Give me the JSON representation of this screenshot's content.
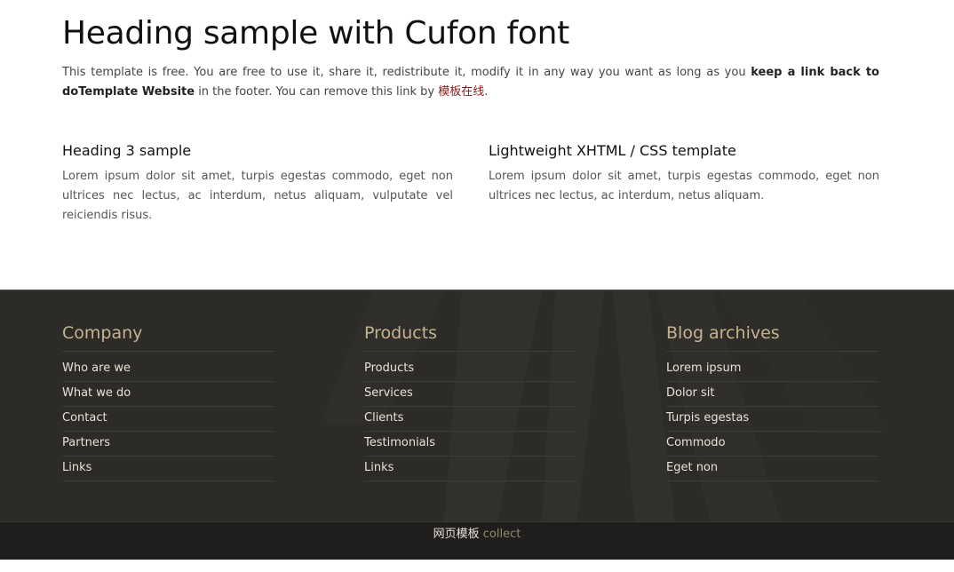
{
  "main": {
    "heading": "Heading sample with Cufon font",
    "intro": {
      "text1": "This template is free. You are free to use it, share it, redistribute it, modify it in any way you want as long as you ",
      "bold": "keep a link back to doTemplate Website",
      "text2": " in the footer. You can remove this link by ",
      "link": "模板在线",
      "text3": "."
    },
    "columns": [
      {
        "heading": "Heading 3 sample",
        "body": "Lorem ipsum dolor sit amet, turpis egestas commodo, eget non ultrices nec lectus, ac interdum, netus aliquam, vulputate vel reiciendis risus."
      },
      {
        "heading": "Lightweight XHTML / CSS template",
        "body": "Lorem ipsum dolor sit amet, turpis egestas commodo, eget non ultrices nec lectus, ac interdum, netus aliquam."
      }
    ]
  },
  "footer": {
    "columns": [
      {
        "title": "Company",
        "links": [
          "Who are we",
          "What we do",
          "Contact",
          "Partners",
          "Links"
        ]
      },
      {
        "title": "Products",
        "links": [
          "Products",
          "Services",
          "Clients",
          "Testimonials",
          "Links"
        ]
      },
      {
        "title": "Blog archives",
        "links": [
          "Lorem ipsum",
          "Dolor sit",
          "Turpis egestas",
          "Commodo",
          "Eget non"
        ]
      }
    ],
    "bottom_link1": "网页模板",
    "bottom_link2": "collect"
  },
  "colors": {
    "footer_bg": "#2c2b28",
    "footer_heading": "#c6b38e",
    "link_red": "#8b1a1a"
  }
}
